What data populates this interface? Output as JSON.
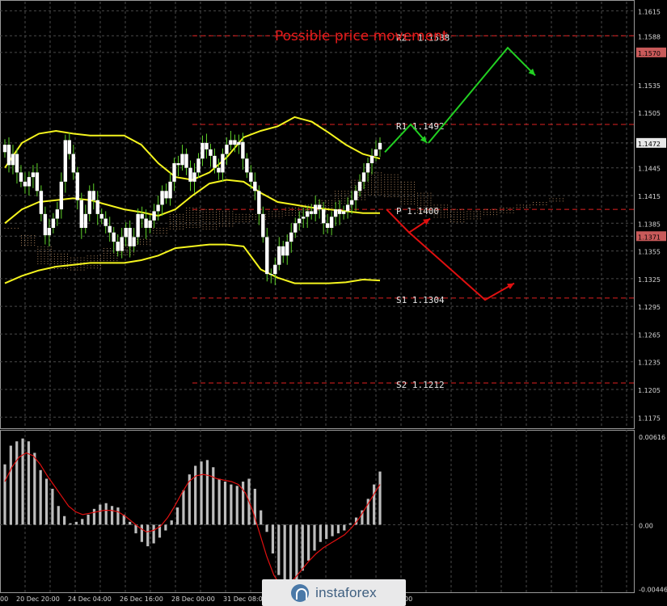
{
  "chart_data": [
    {
      "type": "candlestick",
      "title": "Possible price movement",
      "y_ticks": [
        "1.1615",
        "1.1588",
        "1.1570",
        "1.1535",
        "1.1505",
        "1.1472",
        "1.1445",
        "1.1415",
        "1.1385",
        "1.1371",
        "1.1355",
        "1.1325",
        "1.1295",
        "1.1265",
        "1.1235",
        "1.1205",
        "1.1175"
      ],
      "y_tick_values": [
        1.1615,
        1.1588,
        1.157,
        1.1535,
        1.1505,
        1.1472,
        1.1445,
        1.1415,
        1.1385,
        1.1371,
        1.1355,
        1.1325,
        1.1295,
        1.1265,
        1.1235,
        1.1205,
        1.1175
      ],
      "highlighted_prices": [
        {
          "label": "1.1570",
          "value": 1.157
        },
        {
          "label": "1.1472",
          "value": 1.1472
        },
        {
          "label": "1.1371",
          "value": 1.1371
        }
      ],
      "x_ticks": [
        "00",
        "20 Dec 20:00",
        "24 Dec 04:00",
        "26 Dec 16:00",
        "28 Dec 00:00",
        "31 Dec 08:00",
        "00"
      ],
      "ylim": [
        1.1163,
        1.1625
      ],
      "levels": [
        {
          "label": "R2. 1.1588",
          "value": 1.1588,
          "color": "#e02020"
        },
        {
          "label": "R1 1.1492",
          "value": 1.1492,
          "color": "#e02020"
        },
        {
          "label": "P 1.1400",
          "value": 1.14,
          "color": "#e02020"
        },
        {
          "label": "S1 1.1304",
          "value": 1.1304,
          "color": "#e02020"
        },
        {
          "label": "S2 1.1212",
          "value": 1.1212,
          "color": "#e02020"
        }
      ],
      "closes": [
        1.147,
        1.1448,
        1.146,
        1.144,
        1.143,
        1.1425,
        1.1435,
        1.144,
        1.142,
        1.1395,
        1.1372,
        1.138,
        1.139,
        1.14,
        1.143,
        1.1475,
        1.146,
        1.144,
        1.141,
        1.138,
        1.1395,
        1.142,
        1.141,
        1.1395,
        1.139,
        1.1382,
        1.1375,
        1.1365,
        1.1355,
        1.137,
        1.138,
        1.136,
        1.137,
        1.1395,
        1.139,
        1.138,
        1.1388,
        1.1398,
        1.1405,
        1.142,
        1.1412,
        1.143,
        1.145,
        1.1448,
        1.146,
        1.1445,
        1.143,
        1.144,
        1.1455,
        1.1472,
        1.1465,
        1.1458,
        1.1445,
        1.144,
        1.146,
        1.147,
        1.1475,
        1.147,
        1.1473,
        1.1455,
        1.144,
        1.143,
        1.142,
        1.1395,
        1.137,
        1.133,
        1.133,
        1.134,
        1.136,
        1.135,
        1.1365,
        1.1375,
        1.1385,
        1.139,
        1.1392,
        1.1398,
        1.1395,
        1.1405,
        1.14,
        1.1385,
        1.138,
        1.1392,
        1.14,
        1.1395,
        1.1398,
        1.1405,
        1.141,
        1.142,
        1.143,
        1.144,
        1.145,
        1.1458,
        1.1465,
        1.1472
      ],
      "bands": {
        "upper": [
          1.1445,
          1.1472,
          1.1482,
          1.1485,
          1.1482,
          1.148,
          1.148,
          1.148,
          1.147,
          1.145,
          1.1435,
          1.1432,
          1.144,
          1.1456,
          1.1478,
          1.1485,
          1.149,
          1.15,
          1.1495,
          1.1483,
          1.147,
          1.146,
          1.1455
        ],
        "middle": [
          1.1385,
          1.14,
          1.1408,
          1.141,
          1.1412,
          1.141,
          1.1405,
          1.14,
          1.1397,
          1.1393,
          1.14,
          1.1415,
          1.1428,
          1.1432,
          1.143,
          1.1418,
          1.1408,
          1.1405,
          1.1402,
          1.14,
          1.1398,
          1.1396,
          1.1396
        ],
        "lower": [
          1.132,
          1.1328,
          1.1334,
          1.1338,
          1.134,
          1.1342,
          1.1342,
          1.1342,
          1.1345,
          1.135,
          1.1358,
          1.136,
          1.1362,
          1.1362,
          1.136,
          1.1335,
          1.1326,
          1.132,
          1.132,
          1.132,
          1.1321,
          1.1324,
          1.1323
        ]
      },
      "scenario_up": [
        [
          1.1462,
          1.1492,
          1.1472
        ],
        [
          1.1472,
          1.1575,
          1.1545
        ]
      ],
      "scenario_down": [
        [
          1.14,
          1.1375,
          1.139
        ],
        [
          1.1375,
          1.1302,
          1.132
        ]
      ]
    },
    {
      "type": "histogram",
      "y_ticks": [
        "0.00616",
        "0.00",
        "-0.00446"
      ],
      "y_tick_values": [
        0.00616,
        0.0,
        -0.00446
      ],
      "ylim": [
        -0.0047,
        0.0066
      ],
      "values": [
        0.0042,
        0.0055,
        0.0058,
        0.006,
        0.0058,
        0.005,
        0.0038,
        0.0032,
        0.0025,
        0.0013,
        0.0006,
        0.0001,
        0.0002,
        0.0004,
        0.0007,
        0.0011,
        0.0014,
        0.0015,
        0.0013,
        0.0012,
        0.0007,
        0.0002,
        -0.0006,
        -0.0012,
        -0.0015,
        -0.0013,
        -0.0009,
        -0.0004,
        0.0003,
        0.0012,
        0.0024,
        0.0035,
        0.0041,
        0.0044,
        0.0045,
        0.004,
        0.0032,
        0.003,
        0.0028,
        0.0027,
        0.003,
        0.0032,
        0.0025,
        0.001,
        -0.0005,
        -0.002,
        -0.0035,
        -0.0042,
        -0.0044,
        -0.004,
        -0.0032,
        -0.0025,
        -0.0018,
        -0.0012,
        -0.001,
        -0.0008,
        -0.0006,
        -0.0004,
        0.0001,
        0.0005,
        0.001,
        0.0018,
        0.0028,
        0.0037
      ],
      "signal": [
        0.003,
        0.004,
        0.0047,
        0.005,
        0.0048,
        0.0042,
        0.0034,
        0.0027,
        0.002,
        0.0013,
        0.0009,
        0.0007,
        0.0008,
        0.0009,
        0.001,
        0.001,
        0.0009,
        0.0006,
        0.0002,
        -0.0002,
        -0.0005,
        -0.0004,
        -0.0001,
        0.0005,
        0.0013,
        0.0022,
        0.003,
        0.0034,
        0.0035,
        0.0034,
        0.0032,
        0.0031,
        0.003,
        0.0028,
        0.0022,
        0.001,
        -0.0006,
        -0.0022,
        -0.0035,
        -0.0043,
        -0.0042,
        -0.0037,
        -0.0031,
        -0.0025,
        -0.002,
        -0.0016,
        -0.0013,
        -0.001,
        -0.0007,
        -0.0002,
        0.0004,
        0.0012,
        0.002,
        0.0028
      ]
    }
  ],
  "watermark": {
    "text": "instaforex"
  },
  "colors": {
    "background": "#000000",
    "grid": "#4a4a4a",
    "bollinger": "#f5f51e",
    "candle": "#ffffff",
    "wick": "#5fd32a",
    "level": "#e02020",
    "scenario_up": "#22d022",
    "scenario_down": "#e01010",
    "cloud": "#d2a070",
    "price_tag_bg": "#e8e8e8",
    "price_tag_highlight": "#c95a5a",
    "histogram": "#bdbdbd",
    "signal": "#e01010",
    "axis_text": "#d8d8d8"
  }
}
